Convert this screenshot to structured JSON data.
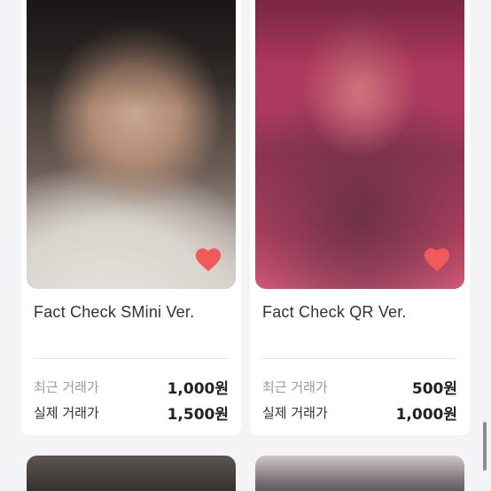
{
  "products": [
    {
      "title": "Fact Check SMini Ver.",
      "recent_label": "최근 거래가",
      "recent_price": "1,000원",
      "actual_label": "실제 거래가",
      "actual_price": "1,500원",
      "liked": true
    },
    {
      "title": "Fact Check QR Ver.",
      "recent_label": "최근 거래가",
      "recent_price": "500원",
      "actual_label": "실제 거래가",
      "actual_price": "1,000원",
      "liked": true
    }
  ],
  "icons": {
    "favorite": "heart-icon"
  },
  "colors": {
    "heart": "#f25a5a",
    "muted_label": "#9a9aa0",
    "text": "#333333"
  }
}
